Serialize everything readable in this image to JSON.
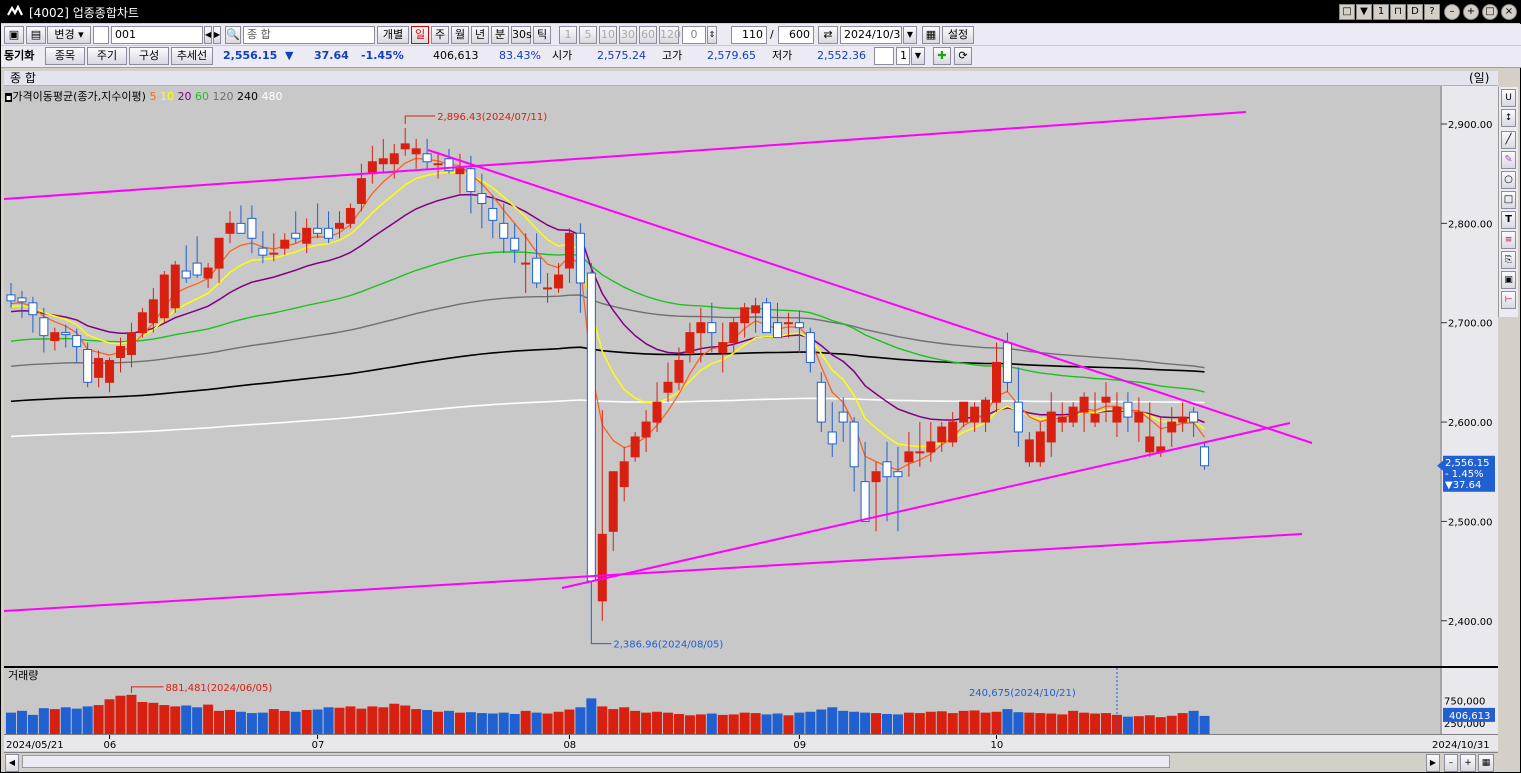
{
  "window": {
    "title": "[4002] 업종종합차트"
  },
  "toolbar1": {
    "change_btn": "변경",
    "code_value": "001",
    "name_value": "종          합",
    "individual_btn": "개별",
    "periods": [
      "일",
      "주",
      "월",
      "년",
      "분",
      "30s",
      "틱"
    ],
    "minute_units": [
      "1",
      "5",
      "10",
      "30",
      "60",
      "120"
    ],
    "offset_value": "0",
    "count_value": "110",
    "slash": "/",
    "total_value": "600",
    "date_value": "2024/10/31",
    "settings_btn": "설정"
  },
  "toolbar2": {
    "sync_label": "동기화",
    "item_btn": "종목",
    "period_btn": "주기",
    "compose_btn": "구성",
    "trendline_btn": "추세선",
    "price": "2,556.15",
    "change_arrow": "▼",
    "change": "37.64",
    "change_pct": "-1.45%",
    "volume": "406,613",
    "volume_ratio": "83.43%",
    "open_label": "시가",
    "open": "2,575.24",
    "high_label": "고가",
    "high": "2,579.65",
    "low_label": "저가",
    "low": "2,552.36",
    "spin_value": "1"
  },
  "chart_header": {
    "name": "종      합",
    "unit": "(일)"
  },
  "legend": {
    "title": "가격이동평균(종가,지수이평)",
    "items": [
      {
        "label": "5",
        "color": "#ff6020"
      },
      {
        "label": "10",
        "color": "#ffff00"
      },
      {
        "label": "20",
        "color": "#800080"
      },
      {
        "label": "60",
        "color": "#20c020"
      },
      {
        "label": "120",
        "color": "#707070"
      },
      {
        "label": "240",
        "color": "#000000"
      },
      {
        "label": "480",
        "color": "#ffffff"
      }
    ]
  },
  "annotations": {
    "high": "2,896.43(2024/07/11)",
    "low": "2,386.96(2024/08/05)",
    "vol_high": "881,481(2024/06/05)",
    "vol_mark": "240,675(2024/10/21)"
  },
  "price_axis": {
    "ticks": [
      "2,900.00",
      "2,800.00",
      "2,700.00",
      "2,600.00",
      "2,500.00",
      "2,400.00"
    ],
    "current_price": "2,556.15",
    "current_pct": "- 1.45%",
    "current_change": "▼37.64"
  },
  "volume_panel": {
    "title": "거래량",
    "ticks": [
      "750,000",
      "500,000",
      "250,000"
    ],
    "current": "406,613"
  },
  "x_axis": {
    "start": "2024/05/21",
    "end": "2024/10/31",
    "months": [
      "06",
      "07",
      "08",
      "09",
      "10"
    ]
  },
  "colors": {
    "up": "#d82010",
    "down": "#2060d0",
    "trend": "#ff00ff",
    "bg": "#c8c8c8"
  },
  "chart_data": {
    "type": "candlestick",
    "dates": [
      "05/21",
      "05/22",
      "05/23",
      "05/24",
      "05/27",
      "05/28",
      "05/29",
      "05/30",
      "05/31",
      "06/03",
      "06/04",
      "06/05",
      "06/07",
      "06/10",
      "06/11",
      "06/12",
      "06/13",
      "06/14",
      "06/17",
      "06/18",
      "06/19",
      "06/20",
      "06/21",
      "06/24",
      "06/25",
      "06/26",
      "06/27",
      "06/28",
      "07/01",
      "07/02",
      "07/03",
      "07/04",
      "07/05",
      "07/08",
      "07/09",
      "07/10",
      "07/11",
      "07/12",
      "07/15",
      "07/16",
      "07/17",
      "07/18",
      "07/19",
      "07/22",
      "07/23",
      "07/24",
      "07/25",
      "07/26",
      "07/29",
      "07/30",
      "07/31",
      "08/01",
      "08/02",
      "08/05",
      "08/06",
      "08/07",
      "08/08",
      "08/09",
      "08/12",
      "08/13",
      "08/14",
      "08/16",
      "08/19",
      "08/20",
      "08/21",
      "08/22",
      "08/23",
      "08/26",
      "08/27",
      "08/28",
      "08/29",
      "08/30",
      "09/02",
      "09/03",
      "09/04",
      "09/05",
      "09/06",
      "09/09",
      "09/10",
      "09/11",
      "09/12",
      "09/13",
      "09/19",
      "09/20",
      "09/23",
      "09/24",
      "09/25",
      "09/26",
      "09/27",
      "09/30",
      "10/02",
      "10/04",
      "10/07",
      "10/08",
      "10/10",
      "10/11",
      "10/14",
      "10/15",
      "10/16",
      "10/17",
      "10/18",
      "10/21",
      "10/22",
      "10/23",
      "10/24",
      "10/25",
      "10/28",
      "10/29",
      "10/30",
      "10/31"
    ],
    "open": [
      2728,
      2725,
      2720,
      2705,
      2682,
      2690,
      2687,
      2673,
      2645,
      2640,
      2665,
      2668,
      2690,
      2700,
      2705,
      2715,
      2752,
      2760,
      2745,
      2755,
      2790,
      2800,
      2805,
      2775,
      2770,
      2775,
      2790,
      2780,
      2795,
      2795,
      2795,
      2800,
      2820,
      2850,
      2860,
      2860,
      2875,
      2870,
      2870,
      2860,
      2865,
      2850,
      2855,
      2830,
      2815,
      2800,
      2785,
      2760,
      2765,
      2735,
      2735,
      2755,
      2790,
      2750,
      2420,
      2490,
      2535,
      2565,
      2585,
      2600,
      2630,
      2640,
      2670,
      2690,
      2700,
      2670,
      2680,
      2700,
      2710,
      2720,
      2700,
      2700,
      2700,
      2690,
      2640,
      2590,
      2610,
      2600,
      2540,
      2540,
      2560,
      2550,
      2560,
      2570,
      2570,
      2580,
      2580,
      2600,
      2600,
      2600,
      2620,
      2680,
      2620,
      2560,
      2560,
      2580,
      2600,
      2600,
      2610,
      2600,
      2620,
      2600,
      2620,
      2600,
      2570,
      2570,
      2590,
      2600,
      2610,
      2575
    ],
    "high": [
      2740,
      2732,
      2726,
      2715,
      2695,
      2698,
      2694,
      2680,
      2672,
      2665,
      2685,
      2700,
      2715,
      2735,
      2752,
      2762,
      2778,
      2787,
      2760,
      2770,
      2812,
      2818,
      2818,
      2792,
      2790,
      2790,
      2812,
      2805,
      2820,
      2812,
      2812,
      2820,
      2860,
      2878,
      2885,
      2880,
      2896,
      2885,
      2885,
      2872,
      2875,
      2870,
      2868,
      2850,
      2828,
      2820,
      2800,
      2790,
      2790,
      2750,
      2760,
      2795,
      2800,
      2760,
      2612,
      2545,
      2575,
      2590,
      2612,
      2640,
      2660,
      2675,
      2700,
      2715,
      2720,
      2700,
      2705,
      2720,
      2725,
      2725,
      2720,
      2710,
      2712,
      2695,
      2650,
      2620,
      2625,
      2605,
      2580,
      2560,
      2580,
      2575,
      2590,
      2600,
      2600,
      2600,
      2610,
      2620,
      2620,
      2625,
      2680,
      2690,
      2655,
      2590,
      2600,
      2630,
      2620,
      2620,
      2630,
      2630,
      2640,
      2630,
      2630,
      2625,
      2620,
      2605,
      2615,
      2620,
      2615,
      2580
    ],
    "low": [
      2715,
      2705,
      2690,
      2670,
      2672,
      2675,
      2660,
      2635,
      2635,
      2630,
      2650,
      2655,
      2685,
      2690,
      2700,
      2710,
      2740,
      2745,
      2735,
      2740,
      2780,
      2790,
      2770,
      2760,
      2762,
      2768,
      2780,
      2770,
      2785,
      2780,
      2785,
      2795,
      2812,
      2840,
      2850,
      2845,
      2868,
      2855,
      2855,
      2845,
      2850,
      2830,
      2810,
      2795,
      2785,
      2770,
      2760,
      2730,
      2735,
      2720,
      2730,
      2740,
      2710,
      2387,
      2400,
      2470,
      2520,
      2560,
      2570,
      2590,
      2620,
      2632,
      2660,
      2660,
      2670,
      2650,
      2670,
      2685,
      2690,
      2690,
      2690,
      2685,
      2670,
      2650,
      2590,
      2565,
      2580,
      2530,
      2510,
      2490,
      2500,
      2490,
      2545,
      2555,
      2560,
      2570,
      2575,
      2595,
      2590,
      2590,
      2610,
      2630,
      2575,
      2555,
      2555,
      2565,
      2590,
      2595,
      2590,
      2595,
      2600,
      2585,
      2590,
      2580,
      2565,
      2565,
      2575,
      2590,
      2585,
      2552
    ],
    "close": [
      2722,
      2721,
      2708,
      2687,
      2690,
      2688,
      2676,
      2640,
      2664,
      2662,
      2676,
      2690,
      2710,
      2723,
      2748,
      2758,
      2745,
      2748,
      2755,
      2785,
      2800,
      2790,
      2785,
      2768,
      2770,
      2783,
      2785,
      2795,
      2790,
      2785,
      2800,
      2815,
      2845,
      2862,
      2865,
      2870,
      2880,
      2875,
      2862,
      2860,
      2853,
      2855,
      2832,
      2820,
      2803,
      2785,
      2773,
      2760,
      2740,
      2735,
      2748,
      2790,
      2740,
      2440,
      2487,
      2550,
      2560,
      2585,
      2600,
      2620,
      2640,
      2662,
      2690,
      2700,
      2690,
      2680,
      2700,
      2715,
      2717,
      2690,
      2685,
      2700,
      2695,
      2660,
      2600,
      2578,
      2600,
      2555,
      2500,
      2550,
      2545,
      2545,
      2570,
      2570,
      2580,
      2595,
      2600,
      2620,
      2615,
      2622,
      2660,
      2640,
      2590,
      2582,
      2590,
      2610,
      2605,
      2615,
      2625,
      2608,
      2625,
      2615,
      2605,
      2610,
      2585,
      2575,
      2600,
      2605,
      2600,
      2556
    ],
    "volume": [
      480,
      520,
      430,
      580,
      560,
      600,
      570,
      620,
      650,
      780,
      860,
      880,
      720,
      700,
      650,
      620,
      640,
      600,
      660,
      520,
      540,
      500,
      470,
      480,
      560,
      520,
      500,
      540,
      550,
      600,
      590,
      620,
      570,
      620,
      600,
      680,
      640,
      560,
      540,
      500,
      520,
      480,
      490,
      470,
      460,
      480,
      450,
      520,
      480,
      460,
      500,
      550,
      600,
      800,
      620,
      560,
      600,
      520,
      480,
      500,
      480,
      450,
      420,
      440,
      460,
      430,
      440,
      480,
      470,
      440,
      460,
      420,
      480,
      500,
      550,
      600,
      520,
      500,
      480,
      470,
      450,
      440,
      480,
      470,
      500,
      510,
      470,
      520,
      530,
      480,
      500,
      560,
      490,
      480,
      470,
      460,
      440,
      520,
      480,
      460,
      470,
      430,
      390,
      400,
      420,
      380,
      410,
      470,
      520,
      407
    ]
  }
}
